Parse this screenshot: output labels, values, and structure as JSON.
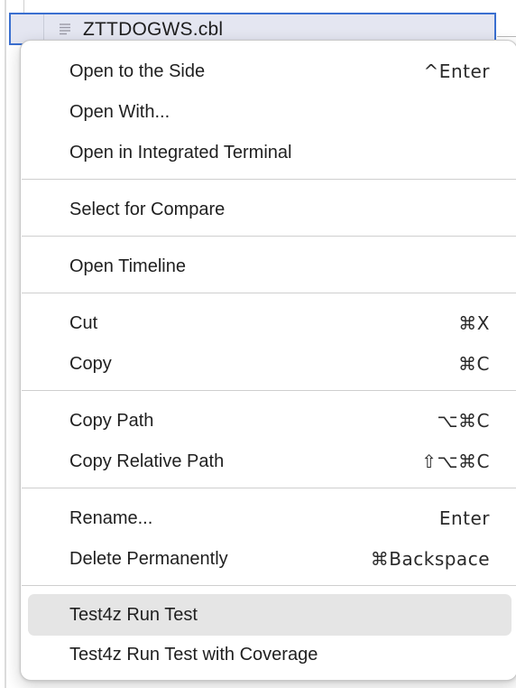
{
  "explorer": {
    "selected_file": {
      "name": "ZTTDOGWS.cbl",
      "icon": "lines-file-icon"
    }
  },
  "context_menu": {
    "groups": [
      {
        "items": [
          {
            "label": "Open to the Side",
            "shortcut": "^Enter"
          },
          {
            "label": "Open With...",
            "shortcut": ""
          },
          {
            "label": "Open in Integrated Terminal",
            "shortcut": ""
          }
        ]
      },
      {
        "items": [
          {
            "label": "Select for Compare",
            "shortcut": ""
          }
        ]
      },
      {
        "items": [
          {
            "label": "Open Timeline",
            "shortcut": ""
          }
        ]
      },
      {
        "items": [
          {
            "label": "Cut",
            "shortcut": "⌘X"
          },
          {
            "label": "Copy",
            "shortcut": "⌘C"
          }
        ]
      },
      {
        "items": [
          {
            "label": "Copy Path",
            "shortcut": "⌥⌘C"
          },
          {
            "label": "Copy Relative Path",
            "shortcut": "⇧⌥⌘C"
          }
        ]
      },
      {
        "items": [
          {
            "label": "Rename...",
            "shortcut": "Enter"
          },
          {
            "label": "Delete Permanently",
            "shortcut": "⌘Backspace"
          }
        ]
      },
      {
        "items": [
          {
            "label": "Test4z Run Test",
            "shortcut": "",
            "highlighted": true
          },
          {
            "label": "Test4z Run Test with Coverage",
            "shortcut": ""
          }
        ]
      }
    ]
  },
  "colors": {
    "selection_border": "#3a6fd0",
    "selection_fill": "#e4e6f1",
    "hover_fill": "#e5e5e5"
  }
}
